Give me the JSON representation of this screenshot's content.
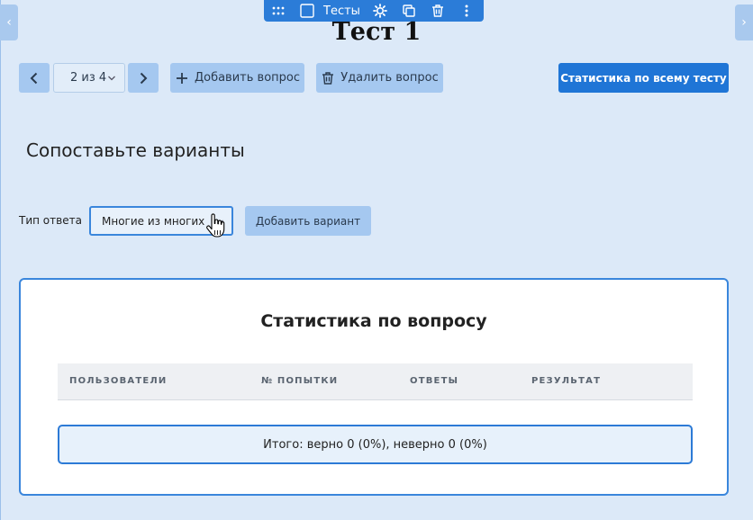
{
  "widget_toolbar": {
    "label": "Тесты"
  },
  "test": {
    "title": "Тест 1"
  },
  "navigation": {
    "page_indicator": "2 из 4",
    "add_question_label": "Добавить вопрос",
    "delete_question_label": "Удалить вопрос",
    "stats_all_label": "Статистика по всему тесту"
  },
  "question": {
    "title": "Сопоставьте варианты",
    "answer_type_label": "Тип ответа",
    "answer_type_value": "Многие из многих",
    "add_variant_label": "Добавить вариант"
  },
  "stats": {
    "title": "Статистика по вопросу",
    "columns": [
      "ПОЛЬЗОВАТЕЛИ",
      "№ ПОПЫТКИ",
      "ОТВЕТЫ",
      "РЕЗУЛЬТАТ"
    ],
    "totals": "Итого: верно 0 (0%), неверно 0 (0%)"
  },
  "colors": {
    "accent": "#1f75d6",
    "button_bg": "#a5c8f0",
    "page_bg": "#dce9f8"
  }
}
